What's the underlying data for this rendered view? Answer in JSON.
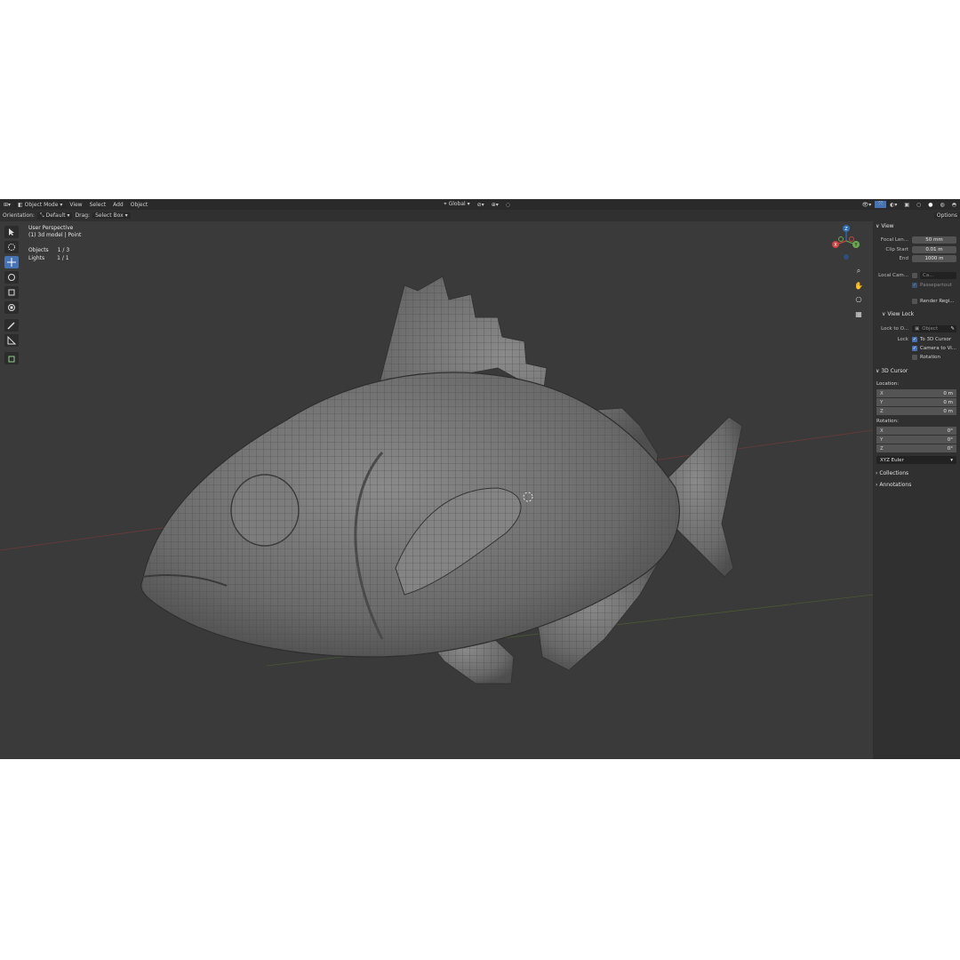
{
  "topbar": {
    "mode": "Object Mode",
    "menus": [
      "View",
      "Select",
      "Add",
      "Object"
    ],
    "transform_orientation": "Global"
  },
  "toolbar": {
    "orientation_label": "Orientation:",
    "orientation_value": "Default",
    "drag_label": "Drag:",
    "drag_value": "Select Box",
    "options_label": "Options"
  },
  "viewport": {
    "view_name": "User Perspective",
    "collection_info": "(1) 3d model | Point",
    "stats": [
      {
        "label": "Objects",
        "value": "1 / 3"
      },
      {
        "label": "Lights",
        "value": "1 / 1"
      }
    ]
  },
  "gizmo": {
    "x": "X",
    "y": "Y",
    "z": "Z"
  },
  "sidebar": {
    "view_header": "View",
    "focal_label": "Focal Len...",
    "focal_value": "50 mm",
    "clip_start_label": "Clip Start",
    "clip_start_value": "0.01 m",
    "end_label": "End",
    "end_value": "1000 m",
    "local_cam_label": "Local Cam...",
    "local_cam_value": "Ca...",
    "passepartout_label": "Passepartout",
    "render_region_label": "Render Regi...",
    "view_lock_header": "View Lock",
    "lock_to_label": "Lock to O...",
    "lock_to_placeholder": "Object",
    "lock_label": "Lock",
    "to_3d_cursor_label": "To 3D Cursor",
    "camera_to_view_label": "Camera to Vi...",
    "rotation_label": "Rotation",
    "cursor_header": "3D Cursor",
    "location_label": "Location:",
    "location": [
      {
        "axis": "X",
        "value": "0 m"
      },
      {
        "axis": "Y",
        "value": "0 m"
      },
      {
        "axis": "Z",
        "value": "0 m"
      }
    ],
    "rotation_header": "Rotation:",
    "rotation": [
      {
        "axis": "X",
        "value": "0°"
      },
      {
        "axis": "Y",
        "value": "0°"
      },
      {
        "axis": "Z",
        "value": "0°"
      }
    ],
    "rotation_mode": "XYZ Euler",
    "collections_header": "Collections",
    "annotations_header": "Annotations"
  }
}
